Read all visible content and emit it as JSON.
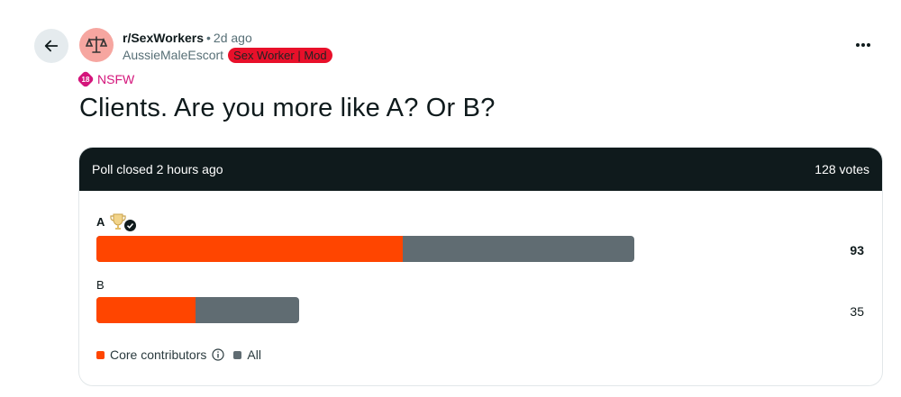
{
  "post": {
    "subreddit": "r/SexWorkers",
    "separator": "•",
    "age": "2d ago",
    "author": "AussieMaleEscort",
    "flair": "Sex Worker | Mod",
    "nsfw_label": "NSFW",
    "nsfw_badge": "18",
    "title": "Clients. Are you more like A? Or B?"
  },
  "poll": {
    "status": "Poll closed 2 hours ago",
    "total_votes": "128 votes",
    "options": [
      {
        "label": "A",
        "votes": "93",
        "total": 93,
        "core_fraction": 0.569,
        "winner": true
      },
      {
        "label": "B",
        "votes": "35",
        "total": 35,
        "core_fraction": 0.487,
        "winner": false
      }
    ],
    "legend": {
      "core": "Core contributors",
      "all": "All"
    }
  },
  "colors": {
    "core": "#ff4500",
    "all": "#606c72",
    "header_bg": "#0f1a1c",
    "nsfw": "#d4157b",
    "flair": "#e8102a"
  },
  "icons": [
    "back-arrow-icon",
    "scales-icon",
    "more-options-icon",
    "nsfw-icon",
    "trophy-icon",
    "check-icon",
    "info-icon"
  ]
}
